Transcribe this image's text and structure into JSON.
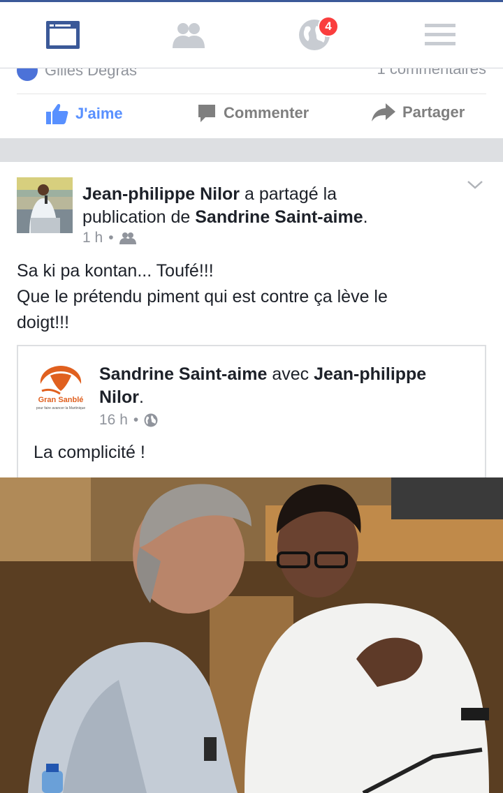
{
  "topnav": {
    "items": [
      {
        "icon": "news-feed-icon",
        "active": true
      },
      {
        "icon": "friends-icon",
        "active": false
      },
      {
        "icon": "globe-notifications-icon",
        "active": false
      },
      {
        "icon": "menu-icon",
        "active": false
      }
    ],
    "notification_count": "4"
  },
  "previous_post": {
    "author_fragment": "Gilles Degras",
    "comments_fragment": "1 commentaires",
    "actions": {
      "like": "J'aime",
      "comment": "Commenter",
      "share": "Partager"
    }
  },
  "post": {
    "author": "Jean-philippe Nilor",
    "shared_text": "a partagé la",
    "publication_of": "publication de",
    "original_author": "Sandrine Saint-aime",
    "period": ".",
    "time": "1 h",
    "separator": "•",
    "audience_icon": "friends-audience-icon",
    "text_lines": [
      "Sa ki pa kontan... Toufé!!!",
      "Que le prétendu piment qui est contre ça lève le",
      "doigt!!!"
    ]
  },
  "shared_post": {
    "author": "Sandrine Saint-aime",
    "with": "avec",
    "tagged": "Jean-philippe",
    "tagged_2": "Nilor",
    "period": ".",
    "time": "16 h",
    "separator": "•",
    "audience_icon": "public-globe-icon",
    "text": "La complicité !",
    "logo_text": "Gran Sanblé",
    "logo_tagline": "pour faire avancer la Martinique"
  },
  "colors": {
    "brand": "#3b5998",
    "liked": "#5890ff",
    "muted": "#90949c",
    "badge": "#fa3e3e"
  }
}
